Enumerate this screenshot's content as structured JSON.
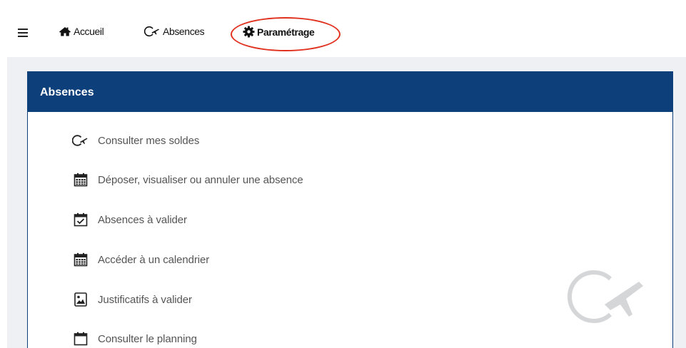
{
  "nav": {
    "menu_icon": "hamburger-icon",
    "items": [
      {
        "label": "Accueil",
        "icon": "home-icon"
      },
      {
        "label": "Absences",
        "icon": "absence-plane-icon"
      },
      {
        "label": "Paramétrage",
        "icon": "gear-icon"
      }
    ],
    "highlight_color": "#e0301e"
  },
  "panel": {
    "title": "Absences",
    "header_color": "#0d3f7a",
    "items": [
      {
        "label": "Consulter mes soldes",
        "icon": "absence-plane-icon"
      },
      {
        "label": "Déposer, visualiser ou annuler une absence",
        "icon": "calendar-icon"
      },
      {
        "label": "Absences à valider",
        "icon": "calendar-check-icon"
      },
      {
        "label": "Accéder à un calendrier",
        "icon": "calendar-icon"
      },
      {
        "label": "Justificatifs à valider",
        "icon": "image-file-icon"
      },
      {
        "label": "Consulter le planning",
        "icon": "calendar-empty-icon"
      }
    ],
    "watermark_icon": "absence-plane-icon"
  }
}
